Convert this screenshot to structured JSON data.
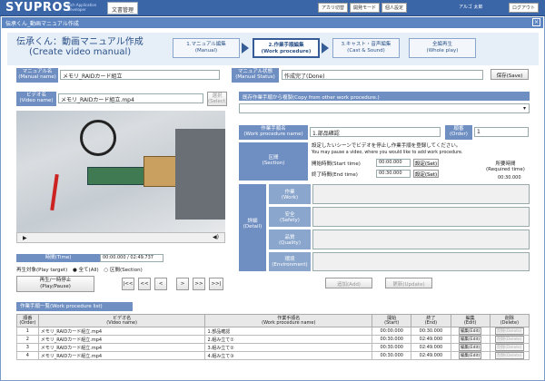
{
  "topbar": {
    "logo": "SYUPROS",
    "logo_sub": "Rich Application Developer",
    "app_name": "文書管理",
    "buttons": [
      "アカリ切替",
      "開発モード",
      "個人設定",
      "ログアウト"
    ],
    "user": "アルゴ 太郎"
  },
  "titlebar": {
    "title": "伝承くん_動画マニュアル作成",
    "close": "×"
  },
  "header": {
    "title_jp": "伝承くん：動画マニュアル作成",
    "title_en": "(Create video manual)",
    "steps": [
      {
        "jp": "1.マニュアル編集",
        "en": "(Manual)"
      },
      {
        "jp": "2.作業手順編集",
        "en": "(Work procedure)"
      },
      {
        "jp": "3.キャスト・音声編集",
        "en": "(Cast & Sound)"
      },
      {
        "jp": "全編再生",
        "en": "(Whole play)"
      }
    ]
  },
  "manual": {
    "name_label": "マニュアル名",
    "name_label_en": "(Manual name)",
    "name_value": "メモリ_RAIDカード組立",
    "status_label": "マニュアル状態",
    "status_label_en": "(Manual Status)",
    "status_value": "作成完了(Done)",
    "save": "保存(Save)"
  },
  "video": {
    "name_label": "ビデオ名",
    "name_label_en": "(Video name)",
    "name_value": "メモリ_RAIDカード組立.mp4",
    "select": "選択",
    "select_en": "(Select)",
    "play_icon": "play-icon",
    "volume_icon": "volume-icon",
    "time_label": "時間(Time)",
    "time_value": "00:00.000 / 02:49.737",
    "target_label": "再生対象(Play target)",
    "target_all": "全て(All)",
    "target_section": "区間(Section)",
    "playpause": "再生/一時停止",
    "playpause_en": "(Play/Pause)",
    "nav": [
      "|<<",
      "<<",
      "<",
      ">",
      ">>",
      ">>|"
    ]
  },
  "copy": {
    "label": "既存作業手順から複製(Copy from other work procedure.)"
  },
  "proc": {
    "name_label": "作業手順名",
    "name_label_en": "(Work procedure name)",
    "name_value": "1.部品確認",
    "order_label": "順番",
    "order_label_en": "(Order)",
    "order_value": "1",
    "section_label": "区間",
    "section_label_en": "(Section)",
    "section_note": "設定したいシーンでビデオを停止し作業手順を登録してください。",
    "section_note_en": "You may pause a video, where you would like to add work procedure.",
    "start_label": "開始時間(Start time)",
    "start_value": "00:00.000",
    "set": "設定(Set)",
    "end_label": "終了時間(End time)",
    "end_value": "00:30.000",
    "req_label": "所要時間",
    "req_label_en": "(Required time)",
    "req_value": "00:30.000",
    "detail_label": "詳細",
    "detail_label_en": "(Detail)",
    "details": [
      {
        "jp": "作業",
        "en": "(Work)"
      },
      {
        "jp": "安全",
        "en": "(Safety)"
      },
      {
        "jp": "品質",
        "en": "(Quality)"
      },
      {
        "jp": "環境",
        "en": "(Environment)"
      }
    ],
    "add": "追加(Add)",
    "update": "更新(Update)"
  },
  "list": {
    "title": "作業手順一覧(Work procedure list)",
    "headers": [
      {
        "jp": "順番",
        "en": "(Order)"
      },
      {
        "jp": "ビデオ名",
        "en": "(Video name)"
      },
      {
        "jp": "作業手順名",
        "en": "(Work procedure name)"
      },
      {
        "jp": "開始",
        "en": "(Start)"
      },
      {
        "jp": "終了",
        "en": "(End)"
      },
      {
        "jp": "編集",
        "en": "(Edit)"
      },
      {
        "jp": "削除",
        "en": "(Delete)"
      }
    ],
    "rows": [
      {
        "order": "1",
        "video": "メモリ_RAIDカード組立.mp4",
        "proc": "1.部品確認",
        "start": "00:00.000",
        "end": "00:30.000",
        "edit": "編集(Edit)",
        "del": "削除(Delete)"
      },
      {
        "order": "2",
        "video": "メモリ_RAIDカード組立.mp4",
        "proc": "2.組み立て①",
        "start": "00:30.000",
        "end": "02:49.000",
        "edit": "編集(Edit)",
        "del": "削除(Delete)"
      },
      {
        "order": "3",
        "video": "メモリ_RAIDカード組立.mp4",
        "proc": "3.組み立て②",
        "start": "00:30.000",
        "end": "02:49.000",
        "edit": "編集(Edit)",
        "del": "削除(Delete)"
      },
      {
        "order": "4",
        "video": "メモリ_RAIDカード組立.mp4",
        "proc": "4.組み立て③",
        "start": "00:30.000",
        "end": "02:49.000",
        "edit": "編集(Edit)",
        "del": "削除(Delete)"
      }
    ]
  }
}
